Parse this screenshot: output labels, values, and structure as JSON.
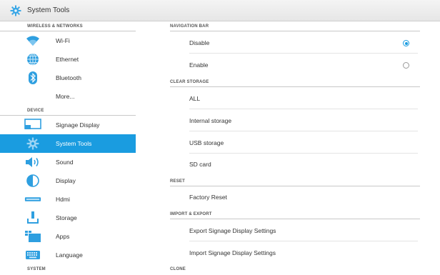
{
  "app": {
    "title": "System Tools",
    "icon": "gear-icon"
  },
  "colors": {
    "accent": "#1a9ce0",
    "icon_blue": "#2e9fe0"
  },
  "sidebar": {
    "sections": [
      {
        "header": "WIRELESS & NETWORKS",
        "items": [
          {
            "label": "Wi-Fi",
            "icon": "wifi-icon"
          },
          {
            "label": "Ethernet",
            "icon": "ethernet-icon"
          },
          {
            "label": "Bluetooth",
            "icon": "bluetooth-icon"
          },
          {
            "label": "More...",
            "icon": ""
          }
        ]
      },
      {
        "header": "DEVICE",
        "items": [
          {
            "label": "Signage Display",
            "icon": "signage-display-icon"
          },
          {
            "label": "System Tools",
            "icon": "gear-icon",
            "active": true
          },
          {
            "label": "Sound",
            "icon": "speaker-icon"
          },
          {
            "label": "Display",
            "icon": "display-icon"
          },
          {
            "label": "Hdmi",
            "icon": "hdmi-icon"
          },
          {
            "label": "Storage",
            "icon": "storage-icon"
          },
          {
            "label": "Apps",
            "icon": "apps-icon"
          },
          {
            "label": "Language",
            "icon": "keyboard-icon"
          }
        ]
      },
      {
        "header": "SYSTEM",
        "items": []
      }
    ]
  },
  "main": {
    "navigation_bar": {
      "header": "NAVIGATION BAR",
      "options": [
        {
          "label": "Disable",
          "selected": true
        },
        {
          "label": "Enable",
          "selected": false
        }
      ]
    },
    "clear_storage": {
      "header": "CLEAR STORAGE",
      "items": [
        "ALL",
        "Internal storage",
        "USB storage",
        "SD card"
      ]
    },
    "reset": {
      "header": "RESET",
      "items": [
        "Factory Reset"
      ]
    },
    "import_export": {
      "header": "IMPORT & EXPORT",
      "items": [
        "Export Signage Display Settings",
        "Import Signage Display Settings"
      ]
    },
    "clone": {
      "header": "CLONE"
    }
  }
}
